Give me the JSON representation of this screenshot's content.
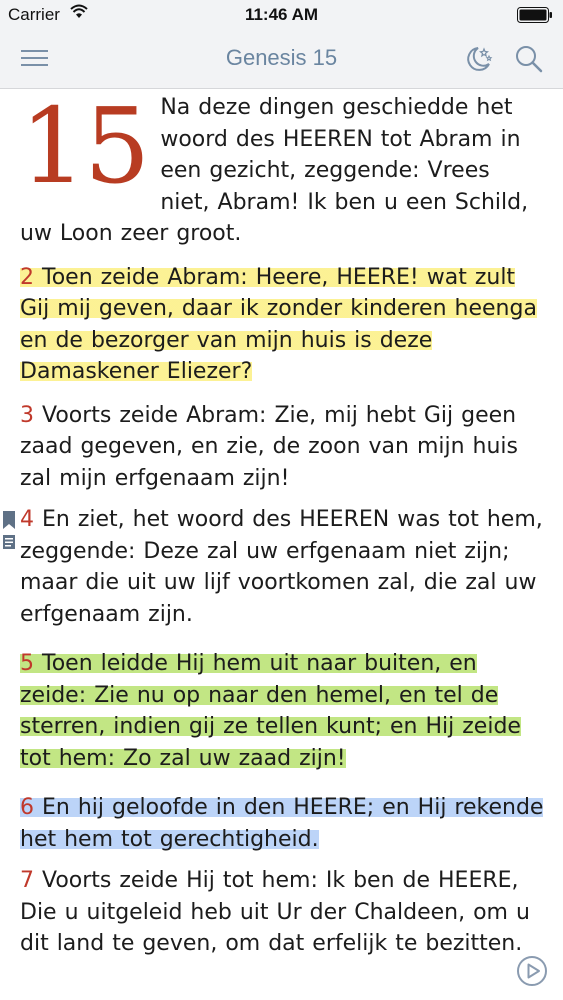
{
  "status": {
    "carrier": "Carrier",
    "time": "11:46 AM"
  },
  "nav": {
    "title": "Genesis 15",
    "icons": [
      "menu-icon",
      "night-mode-icon",
      "search-icon"
    ]
  },
  "chapter": {
    "number": "15",
    "verses": [
      {
        "text": "Na deze dingen geschiedde het woord des HEEREN tot Abram in een gezicht, zeggende: Vrees niet, Abram! Ik ben u een Schild, uw Loon zeer groot."
      },
      {
        "num": "2",
        "text": "Toen zeide Abram: Heere, HEERE! wat zult Gij mij geven, daar ik zonder kinderen heenga en de bezorger van mijn huis is deze Damaskener Eliezer?",
        "highlight": "yellow"
      },
      {
        "num": "3",
        "text": "Voorts zeide Abram: Zie, mij hebt Gij geen zaad gegeven, en zie, de zoon van mijn huis zal mijn erfgenaam zijn!"
      },
      {
        "num": "4",
        "text": "En ziet, het woord des HEEREN was tot hem, zeggende: Deze zal uw erfgenaam niet zijn; maar die uit uw lijf voortkomen zal, die zal uw erfgenaam zijn."
      },
      {
        "num": "5",
        "text": "Toen leidde Hij hem uit naar buiten, en zeide: Zie nu op naar den hemel, en tel de sterren, indien gij ze tellen kunt; en Hij zeide tot hem: Zo zal uw zaad zijn!",
        "highlight": "green"
      },
      {
        "num": "6",
        "text": "En hij geloofde in den HEERE; en Hij rekende het hem tot gerechtigheid.",
        "highlight": "blue"
      },
      {
        "num": "7",
        "text": "Voorts zeide Hij tot hem: Ik ben de HEERE, Die u uitgeleid heb uit Ur der Chaldeen, om u dit land te geven, om dat erfelijk te bezitten."
      }
    ]
  },
  "colors": {
    "verse_number": "#c0392b",
    "nav_title": "#6a85a0",
    "highlight_yellow": "#fcef82",
    "highlight_green": "#b7e16e",
    "highlight_blue": "#b0cdf7"
  }
}
